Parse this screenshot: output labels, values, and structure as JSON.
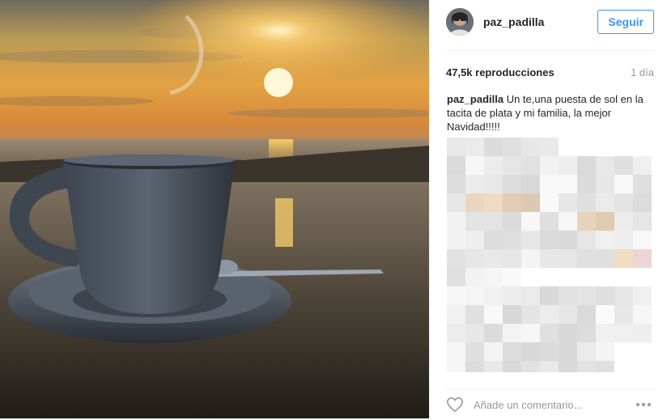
{
  "post": {
    "username": "paz_padilla",
    "follow_label": "Seguir",
    "views": "47,5k reproducciones",
    "time": "1 día",
    "caption_user": "paz_padilla",
    "caption_text": " Un te,una puesta de sol en la tacita de plata y mi familia, la mejor Navidad!!!!!",
    "comment_placeholder": "Añade un comentario..."
  },
  "colors": {
    "accent": "#3897f0",
    "muted": "#999999",
    "text": "#262626"
  },
  "icons": [
    "heart-icon",
    "more-options-icon"
  ]
}
